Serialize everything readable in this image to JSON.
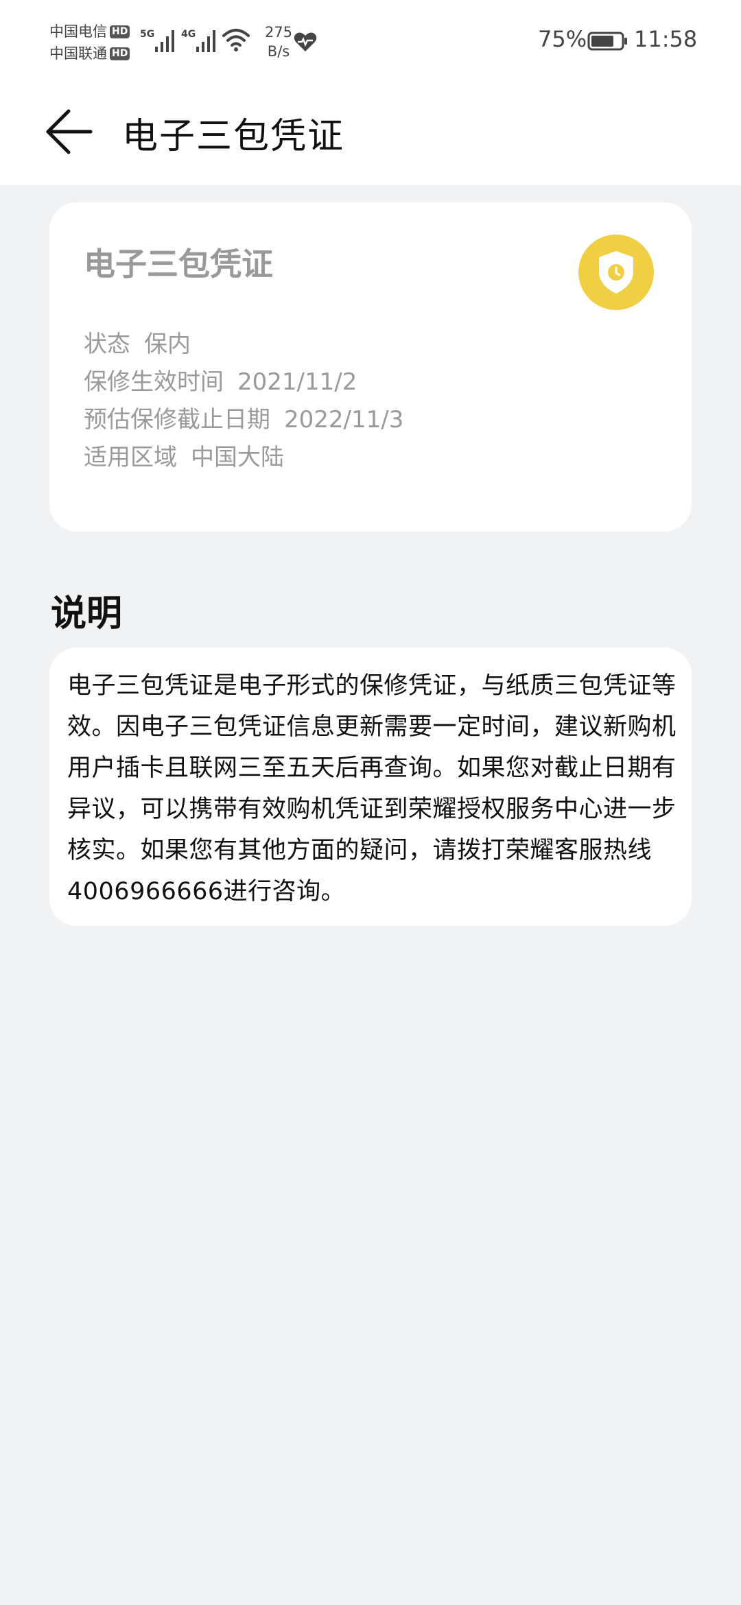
{
  "status_bar": {
    "carrier1": "中国电信",
    "carrier2": "中国联通",
    "hd": "HD",
    "sig1_type": "5G",
    "sig2_type": "4G",
    "speed_value": "275",
    "speed_unit": "B/s",
    "battery": "75%",
    "time": "11:58"
  },
  "header": {
    "title": "电子三包凭证"
  },
  "card": {
    "title": "电子三包凭证",
    "rows": [
      {
        "label": "状态",
        "value": "保内"
      },
      {
        "label": "保修生效时间",
        "value": "2021/11/2"
      },
      {
        "label": "预估保修截止日期",
        "value": "2022/11/3"
      },
      {
        "label": "适用区域",
        "value": "中国大陆"
      }
    ],
    "badge_color": "#f0cf44"
  },
  "explanation": {
    "title": "说明",
    "text": "电子三包凭证是电子形式的保修凭证，与纸质三包凭证等效。因电子三包凭证信息更新需要一定时间，建议新购机用户插卡且联网三至五天后再查询。如果您对截止日期有异议，可以携带有效购机凭证到荣耀授权服务中心进一步核实。如果您有其他方面的疑问，请拨打荣耀客服热线4006966666进行咨询。"
  }
}
